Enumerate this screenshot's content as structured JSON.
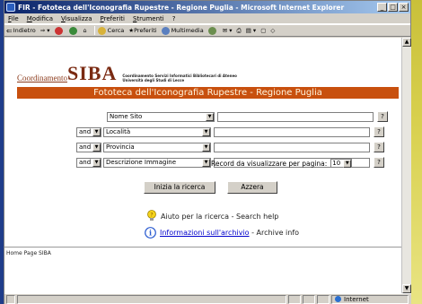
{
  "window": {
    "title": "FIR - Fototeca dell'Iconografia Rupestre - Regione Puglia - Microsoft Internet Explorer",
    "controls": {
      "minimize": "_",
      "maximize": "□",
      "close": "×"
    }
  },
  "menu": [
    "File",
    "Modifica",
    "Visualizza",
    "Preferiti",
    "Strumenti",
    "?"
  ],
  "toolbar": {
    "back": "Indietro",
    "search": "Cerca",
    "favorites": "Preferiti",
    "multimedia": "Multimedia"
  },
  "logo": {
    "coordinamento": "Coordinamento",
    "siba": "SIBA",
    "subtitle_line1": "Coordinamento Servizi Informatici Bibliotecari di Ateneo",
    "subtitle_line2": "Università degli Studi di Lecce"
  },
  "banner": "Fototeca dell'Iconografia Rupestre - Regione Puglia",
  "search": {
    "rows": [
      {
        "operator": "",
        "field": "Nome Sito",
        "value": ""
      },
      {
        "operator": "and",
        "field": "Località",
        "value": ""
      },
      {
        "operator": "and",
        "field": "Provincia",
        "value": ""
      },
      {
        "operator": "and",
        "field": "Descrizione Immagine",
        "value": ""
      }
    ],
    "help_button": "?",
    "records_label": "Record da visualizzare per pagina:",
    "records_value": "10",
    "submit_label": "Inizia la ricerca",
    "reset_label": "Azzera"
  },
  "help": {
    "search_help": "Aiuto per la ricerca - Search help",
    "archive_link": "Informazioni sull'archivio",
    "archive_suffix": " - Archive info"
  },
  "footer": "Home Page SIBA",
  "status": {
    "zone": "Internet"
  },
  "colors": {
    "banner": "#c8500e",
    "titlebar": "#0a246a",
    "logo": "#7a2a12"
  }
}
